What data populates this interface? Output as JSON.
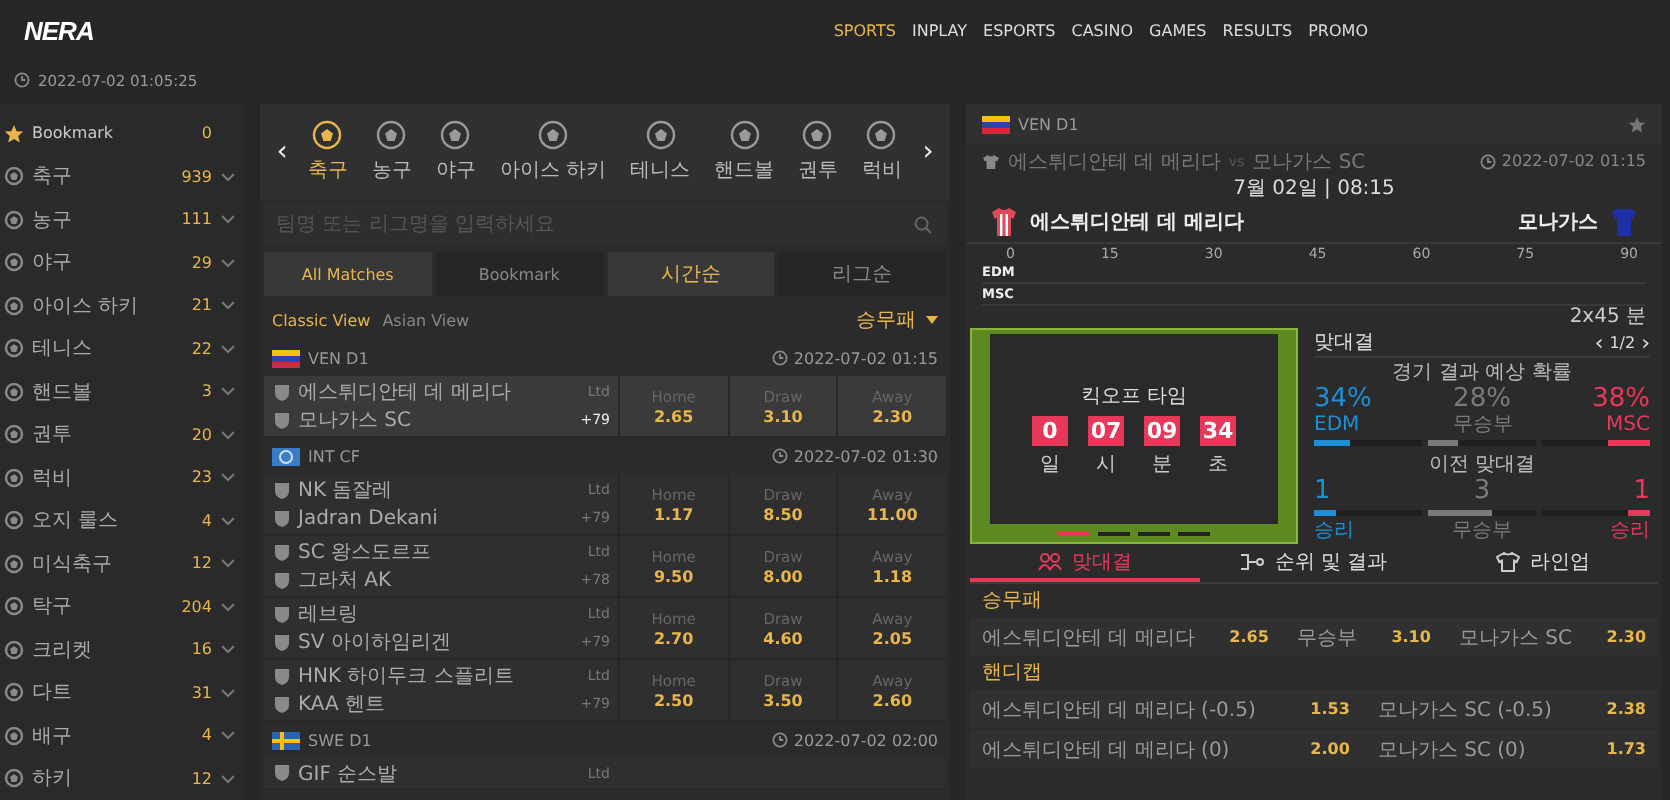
{
  "header": {
    "logo": "NERA",
    "nav": [
      {
        "label": "SPORTS",
        "selected": true
      },
      {
        "label": "INPLAY",
        "selected": false
      },
      {
        "label": "ESPORTS",
        "selected": false
      },
      {
        "label": "CASINO",
        "selected": false
      },
      {
        "label": "GAMES",
        "selected": false
      },
      {
        "label": "RESULTS",
        "selected": false
      },
      {
        "label": "PROMO",
        "selected": false
      }
    ],
    "datetime": "2022-07-02 01:05:25"
  },
  "sidebar": {
    "items": [
      {
        "label": "Bookmark",
        "count": "0",
        "kind": "bookmark"
      },
      {
        "label": "축구",
        "count": "939",
        "kind": "sport"
      },
      {
        "label": "농구",
        "count": "111",
        "kind": "sport"
      },
      {
        "label": "야구",
        "count": "29",
        "kind": "sport"
      },
      {
        "label": "아이스 하키",
        "count": "21",
        "kind": "sport"
      },
      {
        "label": "테니스",
        "count": "22",
        "kind": "sport"
      },
      {
        "label": "핸드볼",
        "count": "3",
        "kind": "sport"
      },
      {
        "label": "권투",
        "count": "20",
        "kind": "sport"
      },
      {
        "label": "럭비",
        "count": "23",
        "kind": "sport"
      },
      {
        "label": "오지 룰스",
        "count": "4",
        "kind": "sport"
      },
      {
        "label": "미식축구",
        "count": "12",
        "kind": "sport"
      },
      {
        "label": "탁구",
        "count": "204",
        "kind": "sport"
      },
      {
        "label": "크리켓",
        "count": "16",
        "kind": "sport"
      },
      {
        "label": "다트",
        "count": "31",
        "kind": "sport"
      },
      {
        "label": "배구",
        "count": "4",
        "kind": "sport"
      },
      {
        "label": "하키",
        "count": "12",
        "kind": "sport"
      }
    ]
  },
  "sports_tabs": {
    "prev": "‹",
    "next": "›",
    "items": [
      {
        "label": "축구",
        "selected": true
      },
      {
        "label": "농구",
        "selected": false
      },
      {
        "label": "야구",
        "selected": false
      },
      {
        "label": "아이스 하키",
        "selected": false
      },
      {
        "label": "테니스",
        "selected": false
      },
      {
        "label": "핸드볼",
        "selected": false
      },
      {
        "label": "권투",
        "selected": false
      },
      {
        "label": "럭비",
        "selected": false
      }
    ]
  },
  "search": {
    "placeholder": "팀명 또는 리그명을 입력하세요"
  },
  "filter_tabs": [
    {
      "label": "All Matches",
      "selected": true
    },
    {
      "label": "Bookmark",
      "selected": false
    }
  ],
  "sort_tabs": [
    {
      "label": "시간순",
      "selected": true
    },
    {
      "label": "리그순",
      "selected": false
    }
  ],
  "views": [
    {
      "label": "Classic View",
      "selected": true
    },
    {
      "label": "Asian View",
      "selected": false
    }
  ],
  "market_select": "승무패",
  "leagues": [
    {
      "name": "VEN D1",
      "time": "2022-07-02 01:15",
      "matches": [
        {
          "home": "에스튀디안테 데 메리다",
          "away": "모나가스 SC",
          "stats": "Ltd",
          "more": "+79",
          "selected": true,
          "odds": [
            {
              "label": "Home",
              "value": "2.65"
            },
            {
              "label": "Draw",
              "value": "3.10"
            },
            {
              "label": "Away",
              "value": "2.30"
            }
          ]
        }
      ]
    },
    {
      "name": "INT CF",
      "time": "2022-07-02 01:30",
      "matches": [
        {
          "home": "NK 돔잘레",
          "away": "Jadran Dekani",
          "stats": "Ltd",
          "more": "+79",
          "selected": false,
          "odds": [
            {
              "label": "Home",
              "value": "1.17"
            },
            {
              "label": "Draw",
              "value": "8.50"
            },
            {
              "label": "Away",
              "value": "11.00"
            }
          ]
        },
        {
          "home": "SC 왕스도르프",
          "away": "그라처 AK",
          "stats": "Ltd",
          "more": "+78",
          "selected": false,
          "odds": [
            {
              "label": "Home",
              "value": "9.50"
            },
            {
              "label": "Draw",
              "value": "8.00"
            },
            {
              "label": "Away",
              "value": "1.18"
            }
          ]
        },
        {
          "home": "레브링",
          "away": "SV 아이하임리겐",
          "stats": "Ltd",
          "more": "+79",
          "selected": false,
          "odds": [
            {
              "label": "Home",
              "value": "2.70"
            },
            {
              "label": "Draw",
              "value": "4.60"
            },
            {
              "label": "Away",
              "value": "2.05"
            }
          ]
        },
        {
          "home": "HNK 하이두크 스플리트",
          "away": "KAA 헨트",
          "stats": "Ltd",
          "more": "+79",
          "selected": false,
          "odds": [
            {
              "label": "Home",
              "value": "2.50"
            },
            {
              "label": "Draw",
              "value": "3.50"
            },
            {
              "label": "Away",
              "value": "2.60"
            }
          ]
        }
      ]
    },
    {
      "name": "SWE D1",
      "time": "2022-07-02 02:00",
      "matches": [
        {
          "home": "GIF 순스발",
          "stats": "Ltd"
        }
      ]
    }
  ],
  "detail": {
    "league": "VEN D1",
    "fixture_home": "에스튀디안테 데 메리다",
    "vs": "vs",
    "fixture_away": "모나가스 SC",
    "time": "2022-07-02 01:15",
    "kickoff_date": "7월 02일 | 08:15",
    "home_team": "에스튀디안테 데 메리다",
    "away_team": "모나가스",
    "timeline": {
      "ticks": [
        "0",
        "15",
        "30",
        "45",
        "60",
        "75",
        "90"
      ],
      "rows": [
        "EDM",
        "MSC"
      ],
      "duration": "2x45 분"
    },
    "countdown": {
      "title": "킥오프 타임",
      "units": [
        {
          "value": "0",
          "label": "일"
        },
        {
          "value": "07",
          "label": "시"
        },
        {
          "value": "09",
          "label": "분"
        },
        {
          "value": "34",
          "label": "초"
        }
      ]
    },
    "slides": [
      {
        "selected": true
      },
      {
        "selected": false
      },
      {
        "selected": false
      },
      {
        "selected": false
      }
    ],
    "h2h": {
      "title": "맞대결",
      "prev": "‹",
      "pager": "1/2",
      "next": "›",
      "prob_title": "경기 결과 예상 확률",
      "probs": [
        {
          "value": "34",
          "unit": "%",
          "label": "EDM",
          "level": 0.34,
          "color": "#1e8fd6"
        },
        {
          "value": "28",
          "unit": "%",
          "label": "무승부",
          "level": 0.28,
          "color": "#7a7a7a"
        },
        {
          "value": "38",
          "unit": "%",
          "label": "MSC",
          "level": 0.38,
          "color": "#e8385a"
        }
      ],
      "prev_title": "이전 맞대결",
      "results": [
        {
          "value": "1",
          "label": "승리",
          "level": 0.2,
          "color": "#1e8fd6"
        },
        {
          "value": "3",
          "label": "무승부",
          "level": 0.6,
          "color": "#7a7a7a"
        },
        {
          "value": "1",
          "label": "승리",
          "level": 0.2,
          "color": "#e8385a"
        }
      ]
    },
    "tabs": [
      {
        "label": "맞대결",
        "kind": "people",
        "selected": true
      },
      {
        "label": "순위 및 결과",
        "kind": "bracket",
        "selected": false
      },
      {
        "label": "라인업",
        "kind": "shirt",
        "selected": false
      }
    ],
    "markets": [
      {
        "title": "승무패",
        "rows": [
          [
            {
              "name": "에스튀디안테 데 메리다",
              "odds": "2.65"
            },
            {
              "name": "무승부",
              "odds": "3.10"
            },
            {
              "name": "모나가스 SC",
              "odds": "2.30"
            }
          ]
        ]
      },
      {
        "title": "핸디캡",
        "rows": [
          [
            {
              "name": "에스튀디안테 데 메리다 (-0.5)",
              "odds": "1.53"
            },
            {
              "name": "모나가스 SC (-0.5)",
              "odds": "2.38"
            }
          ],
          [
            {
              "name": "에스튀디안테 데 메리다 (0)",
              "odds": "2.00"
            },
            {
              "name": "모나가스 SC (0)",
              "odds": "1.73"
            }
          ]
        ]
      }
    ]
  }
}
